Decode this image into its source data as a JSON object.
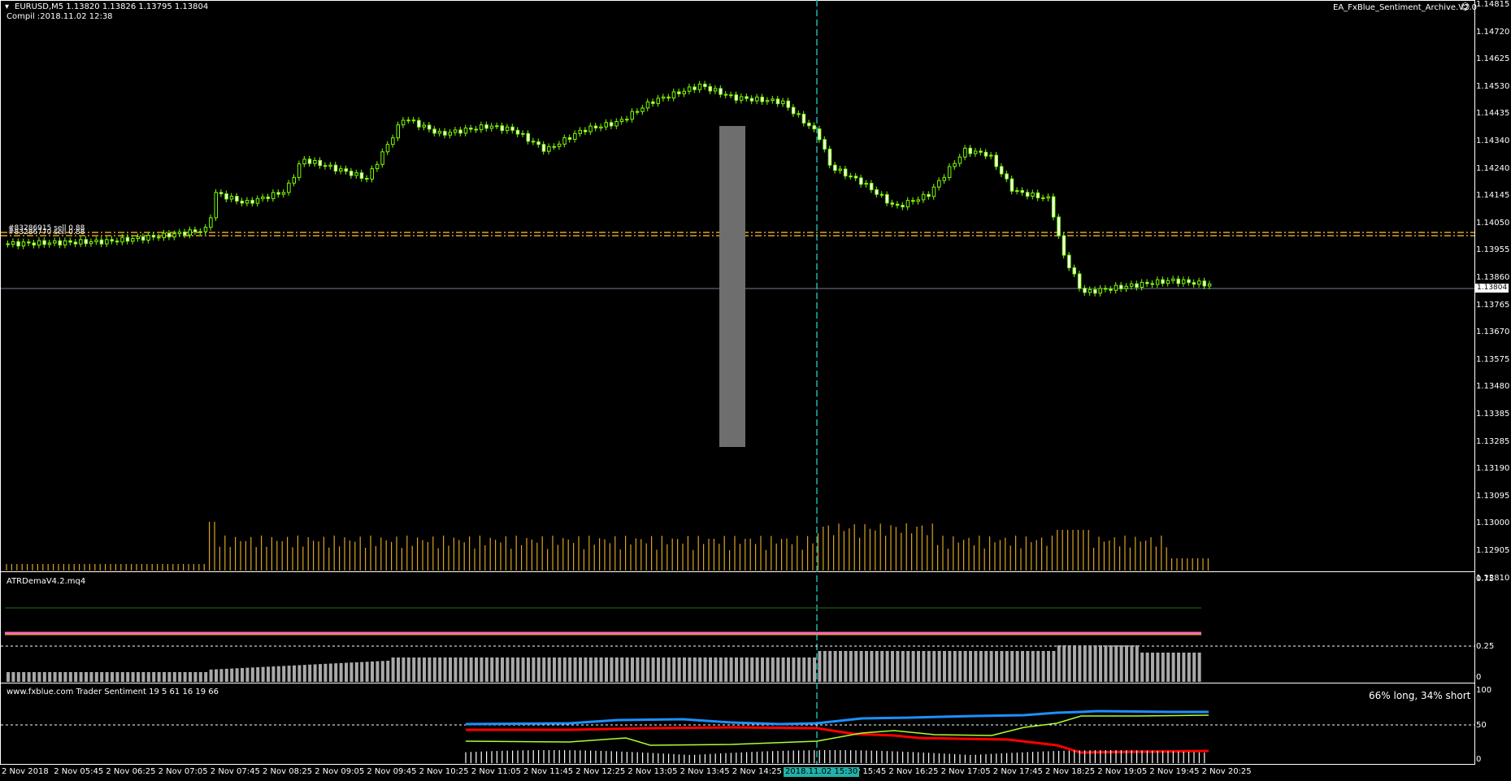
{
  "symbol_info": "EURUSD,M5  1.13820 1.13826 1.13795 1.13804",
  "compile_info": "Compil :2018.11.02 12:38",
  "ea_label": "EA_FxBlue_Sentiment_Archive.V2.0",
  "order_labels": [
    "#83286915 sell 0.88",
    "#83286770 sell 0.88"
  ],
  "current_price": "1.13804",
  "price_axis": [
    "1.14815",
    "1.14720",
    "1.14625",
    "1.14530",
    "1.14435",
    "1.14340",
    "1.14240",
    "1.14145",
    "1.14050",
    "1.13955",
    "1.13860",
    "1.13765",
    "1.13670",
    "1.13575",
    "1.13480",
    "1.13385",
    "1.13285",
    "1.13190",
    "1.13095",
    "1.13000",
    "1.12905",
    "1.12810"
  ],
  "atr_indicator": {
    "title": "ATRDemaV4.2.mq4",
    "axis": [
      "0.75",
      "0.25",
      "0"
    ]
  },
  "sentiment_indicator": {
    "title": "www.fxblue.com Trader Sentiment 19 5 61 16 19 66",
    "summary": "66% long,  34% short",
    "axis": [
      "100",
      "50",
      "0"
    ]
  },
  "crosshair_time": "2018.11.02 15:30",
  "time_axis": [
    "2 Nov 2018",
    "2 Nov 05:45",
    "2 Nov 06:25",
    "2 Nov 07:05",
    "2 Nov 07:45",
    "2 Nov 08:25",
    "2 Nov 09:05",
    "2 Nov 09:45",
    "2 Nov 10:25",
    "2 Nov 11:05",
    "2 Nov 11:45",
    "2 Nov 12:25",
    "2 Nov 13:05",
    "2 Nov 13:45",
    "2 Nov 14:25",
    "2 Nov 15:05",
    "2 Nov 15:45",
    "2 Nov 16:25",
    "2 Nov 17:05",
    "2 Nov 17:45",
    "2 Nov 18:25",
    "2 Nov 19:05",
    "2 Nov 19:45",
    "2 Nov 20:25"
  ],
  "colors": {
    "bull": "#7CFC00",
    "order_line": "#DAA520",
    "crosshair": "#20B2AA",
    "bid_line": "#708090",
    "sentiment_long": "#1E90FF",
    "sentiment_short": "#FF0000",
    "sentiment_mid": "#ADFF2F",
    "summary_text": "#1E90FF"
  }
}
